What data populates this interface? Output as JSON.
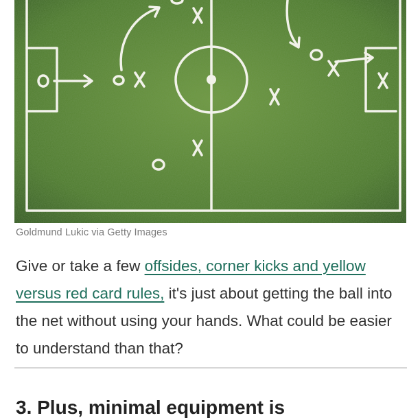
{
  "image": {
    "alt_marks": {
      "x": "X",
      "o": "O"
    },
    "caption": "Goldmund Lukic via Getty Images"
  },
  "article": {
    "paragraph": {
      "before": "Give or take a few ",
      "link": "offsides, corner kicks and yellow versus red card rules,",
      "after": " it's just about getting the ball into the net without using your hands. What could be easier to understand than that?"
    },
    "next_heading": "3. Plus, minimal equipment is"
  }
}
